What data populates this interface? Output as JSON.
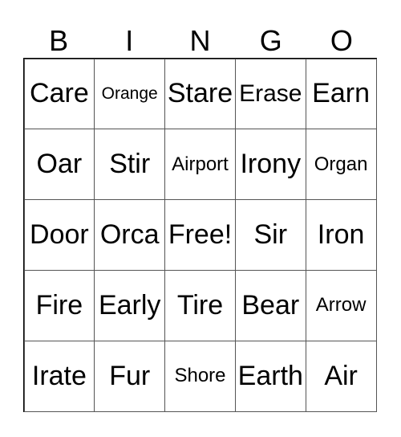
{
  "header": [
    "B",
    "I",
    "N",
    "G",
    "O"
  ],
  "cells": [
    [
      "Care",
      "Orange",
      "Stare",
      "Erase",
      "Earn"
    ],
    [
      "Oar",
      "Stir",
      "Airport",
      "Irony",
      "Organ"
    ],
    [
      "Door",
      "Orca",
      "Free!",
      "Sir",
      "Iron"
    ],
    [
      "Fire",
      "Early",
      "Tire",
      "Bear",
      "Arrow"
    ],
    [
      "Irate",
      "Fur",
      "Shore",
      "Earth",
      "Air"
    ]
  ]
}
